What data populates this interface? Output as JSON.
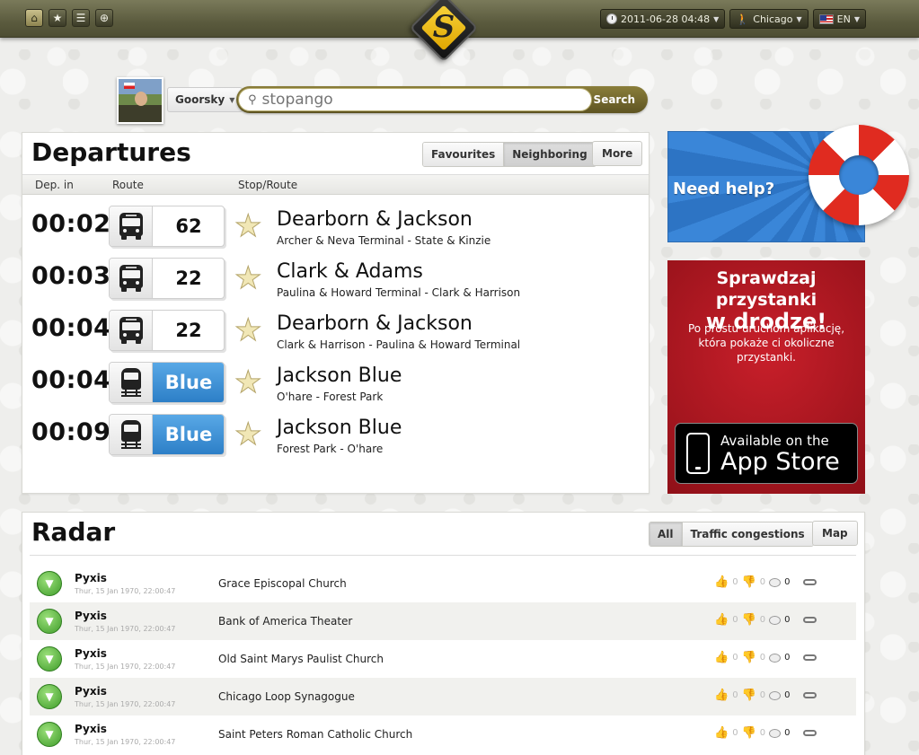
{
  "topbar": {
    "icons": [
      "home-icon",
      "star-icon",
      "list-icon",
      "globe-icon"
    ],
    "datetime": "2011-06-28 04:48",
    "city": "Chicago",
    "language": "EN"
  },
  "search": {
    "user": "Goorsky",
    "placeholder": "stopango",
    "button": "Search"
  },
  "departures": {
    "title": "Departures",
    "tabs": [
      "Favourites",
      "Neighboring"
    ],
    "active_tab": "Neighboring",
    "more": "More",
    "columns": {
      "dep_in": "Dep. in",
      "route": "Route",
      "stop": "Stop/Route"
    },
    "rows": [
      {
        "time": "00:02",
        "vehicle": "bus",
        "route": "62",
        "stop": "Dearborn & Jackson",
        "direction": "Archer & Neva Terminal - State & Kinzie"
      },
      {
        "time": "00:03",
        "vehicle": "bus",
        "route": "22",
        "stop": "Clark & Adams",
        "direction": "Paulina & Howard Terminal - Clark & Harrison"
      },
      {
        "time": "00:04",
        "vehicle": "bus",
        "route": "22",
        "stop": "Dearborn & Jackson",
        "direction": "Clark & Harrison - Paulina & Howard Terminal"
      },
      {
        "time": "00:04",
        "vehicle": "train",
        "route": "Blue",
        "stop": "Jackson Blue",
        "direction": "O'hare - Forest Park"
      },
      {
        "time": "00:09",
        "vehicle": "train",
        "route": "Blue",
        "stop": "Jackson Blue",
        "direction": "Forest Park - O'hare"
      }
    ]
  },
  "ads": {
    "help": "Need help?",
    "app_title_1": "Sprawdzaj przystanki",
    "app_title_2": "w drodze!",
    "app_body": "Po prostu uruchom aplikację, która pokaże ci okoliczne przystanki.",
    "appstore_small": "Available on the",
    "appstore_big": "App Store"
  },
  "radar": {
    "title": "Radar",
    "tabs": [
      "All",
      "Traffic congestions"
    ],
    "active_tab": "All",
    "map": "Map",
    "rows": [
      {
        "name": "Pyxis",
        "date": "Thur, 15 Jan 1970, 22:00:47",
        "place": "Grace Episcopal Church",
        "likes": "0",
        "dislikes": "0",
        "comments": "0"
      },
      {
        "name": "Pyxis",
        "date": "Thur, 15 Jan 1970, 22:00:47",
        "place": "Bank of America Theater",
        "likes": "0",
        "dislikes": "0",
        "comments": "0"
      },
      {
        "name": "Pyxis",
        "date": "Thur, 15 Jan 1970, 22:00:47",
        "place": "Old Saint Marys Paulist Church",
        "likes": "0",
        "dislikes": "0",
        "comments": "0"
      },
      {
        "name": "Pyxis",
        "date": "Thur, 15 Jan 1970, 22:00:47",
        "place": "Chicago Loop Synagogue",
        "likes": "0",
        "dislikes": "0",
        "comments": "0"
      },
      {
        "name": "Pyxis",
        "date": "Thur, 15 Jan 1970, 22:00:47",
        "place": "Saint Peters Roman Catholic Church",
        "likes": "0",
        "dislikes": "0",
        "comments": "0"
      }
    ]
  },
  "colors": {
    "accent": "#6b6b48",
    "route_blue": "#2d7fc7",
    "ad_red": "#c81f2a",
    "help_blue": "#3a86d8"
  }
}
